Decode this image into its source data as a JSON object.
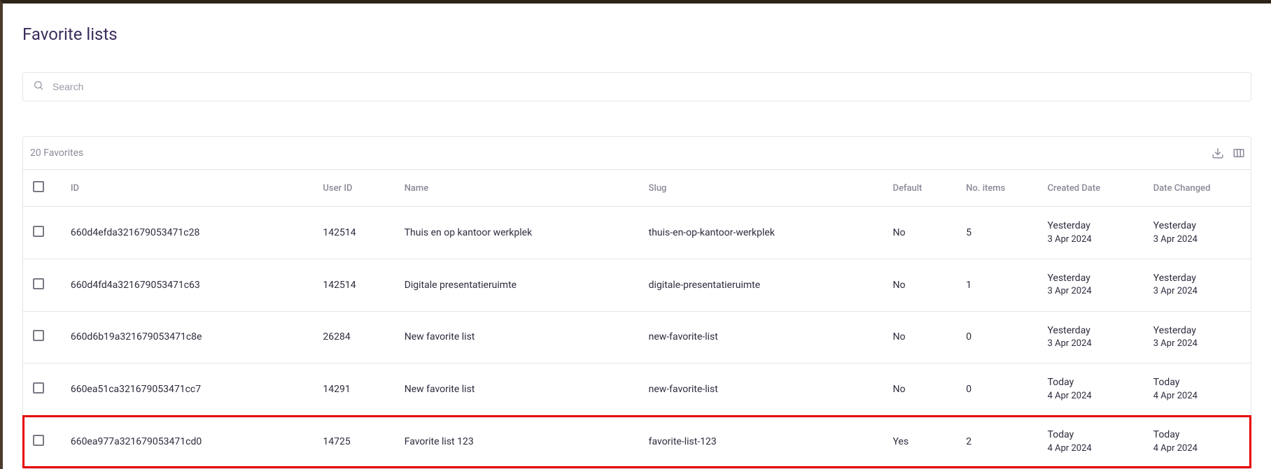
{
  "page": {
    "title": "Favorite lists"
  },
  "search": {
    "placeholder": "Search"
  },
  "panel": {
    "count_label": "20 Favorites"
  },
  "table": {
    "headers": {
      "id": "ID",
      "user_id": "User ID",
      "name": "Name",
      "slug": "Slug",
      "default": "Default",
      "no_items": "No. items",
      "created_date": "Created Date",
      "date_changed": "Date Changed"
    },
    "rows": [
      {
        "id": "660d4efda321679053471c28",
        "user_id": "142514",
        "name": "Thuis en op kantoor werkplek",
        "slug": "thuis-en-op-kantoor-werkplek",
        "default": "No",
        "no_items": "5",
        "created_rel": "Yesterday",
        "created_abs": "3 Apr 2024",
        "changed_rel": "Yesterday",
        "changed_abs": "3 Apr 2024",
        "highlight": false
      },
      {
        "id": "660d4fd4a321679053471c63",
        "user_id": "142514",
        "name": "Digitale presentatieruimte",
        "slug": "digitale-presentatieruimte",
        "default": "No",
        "no_items": "1",
        "created_rel": "Yesterday",
        "created_abs": "3 Apr 2024",
        "changed_rel": "Yesterday",
        "changed_abs": "3 Apr 2024",
        "highlight": false
      },
      {
        "id": "660d6b19a321679053471c8e",
        "user_id": "26284",
        "name": "New favorite list",
        "slug": "new-favorite-list",
        "default": "No",
        "no_items": "0",
        "created_rel": "Yesterday",
        "created_abs": "3 Apr 2024",
        "changed_rel": "Yesterday",
        "changed_abs": "3 Apr 2024",
        "highlight": false
      },
      {
        "id": "660ea51ca321679053471cc7",
        "user_id": "14291",
        "name": "New favorite list",
        "slug": "new-favorite-list",
        "default": "No",
        "no_items": "0",
        "created_rel": "Today",
        "created_abs": "4 Apr 2024",
        "changed_rel": "Today",
        "changed_abs": "4 Apr 2024",
        "highlight": false
      },
      {
        "id": "660ea977a321679053471cd0",
        "user_id": "14725",
        "name": "Favorite list 123",
        "slug": "favorite-list-123",
        "default": "Yes",
        "no_items": "2",
        "created_rel": "Today",
        "created_abs": "4 Apr 2024",
        "changed_rel": "Today",
        "changed_abs": "4 Apr 2024",
        "highlight": true
      }
    ]
  }
}
